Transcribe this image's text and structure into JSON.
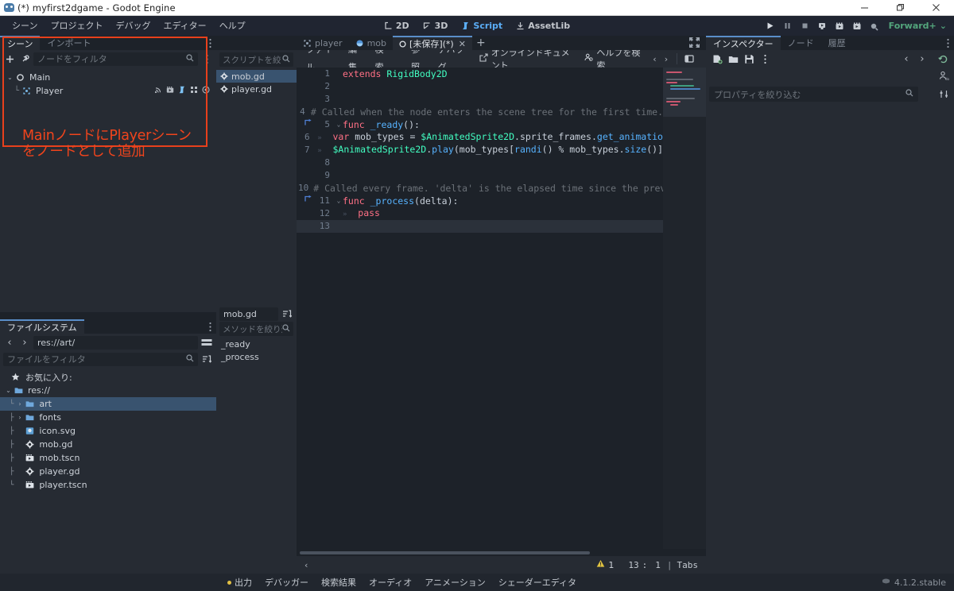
{
  "window": {
    "title": "(*) myfirst2dgame - Godot Engine",
    "logo": "godot-logo",
    "minimize": "—",
    "maximize": "❐",
    "close": "✕"
  },
  "menubar": {
    "items": [
      {
        "label": "シーン"
      },
      {
        "label": "プロジェクト"
      },
      {
        "label": "デバッグ"
      },
      {
        "label": "エディター"
      },
      {
        "label": "ヘルプ"
      }
    ],
    "main_tabs": [
      {
        "label": "2D",
        "icon": "2d-icon",
        "active": false
      },
      {
        "label": "3D",
        "icon": "3d-icon",
        "active": false
      },
      {
        "label": "Script",
        "icon": "script-icon",
        "active": true
      },
      {
        "label": "AssetLib",
        "icon": "assetlib-icon",
        "active": false
      }
    ],
    "play_controls": [
      {
        "name": "play-button",
        "glyph": "▶"
      },
      {
        "name": "pause-button",
        "glyph": "❙❙"
      },
      {
        "name": "stop-button",
        "glyph": "■"
      },
      {
        "name": "play-remote-debug-button",
        "glyph": "⚇"
      },
      {
        "name": "play-scene-button",
        "glyph": "▶"
      },
      {
        "name": "play-custom-scene-button",
        "glyph": "▶"
      },
      {
        "name": "movie-maker-button",
        "glyph": "●"
      }
    ],
    "renderer": {
      "label": "Forward+",
      "chevron": "⌄",
      "color": "#53a57c"
    }
  },
  "scene_panel": {
    "tabs": [
      {
        "label": "シーン",
        "active": true
      },
      {
        "label": "インポート",
        "active": false
      }
    ],
    "toolbar": {
      "add_node": "+",
      "instance_icon": "link-icon",
      "filter_placeholder": "ノードをフィルタ",
      "search_icon": "search-icon",
      "more_icon": "vertical-dots-icon"
    },
    "tree": [
      {
        "label": "Main",
        "depth": 0,
        "icon": "node2d-icon",
        "expander": "⌄",
        "icons": []
      },
      {
        "label": "Player",
        "depth": 1,
        "icon": "instance-icon",
        "expander": "",
        "icons": [
          "signal-icon",
          "instance-scene-icon",
          "script-icon",
          "group-icon",
          "visibility-icon"
        ]
      }
    ]
  },
  "annotation": {
    "text": "MainノードにPlayerシーン\nをノードとして追加",
    "color": "#f1441c"
  },
  "filesystem_panel": {
    "tabs": [
      {
        "label": "ファイルシステム",
        "active": true
      }
    ],
    "nav": {
      "back": "‹",
      "forward": "›",
      "path": "res://art/",
      "split_icon": "split-view-icon"
    },
    "filter": {
      "placeholder": "ファイルをフィルタ",
      "search_icon": "search-icon",
      "sort_icon": "sort-icon"
    },
    "tree": [
      {
        "label": "お気に入り:",
        "depth": 0,
        "icon": "star-icon",
        "expander": "",
        "selected": false
      },
      {
        "label": "res://",
        "depth": 0,
        "icon": "folder-icon",
        "expander": "⌄",
        "selected": false
      },
      {
        "label": "art",
        "depth": 1,
        "icon": "folder-icon",
        "expander": "›",
        "selected": true
      },
      {
        "label": "fonts",
        "depth": 1,
        "icon": "folder-icon",
        "expander": "›",
        "selected": false
      },
      {
        "label": "icon.svg",
        "depth": 1,
        "icon": "image-icon",
        "expander": "",
        "selected": false
      },
      {
        "label": "mob.gd",
        "depth": 1,
        "icon": "gdscript-icon",
        "expander": "",
        "selected": false
      },
      {
        "label": "mob.tscn",
        "depth": 1,
        "icon": "scene-icon",
        "expander": "",
        "selected": false
      },
      {
        "label": "player.gd",
        "depth": 1,
        "icon": "gdscript-icon",
        "expander": "",
        "selected": false
      },
      {
        "label": "player.tscn",
        "depth": 1,
        "icon": "scene-icon",
        "expander": "",
        "selected": false
      }
    ]
  },
  "script_list_panel": {
    "filter_placeholder": "スクリプトを絞り",
    "search_icon": "search-icon",
    "scripts": [
      {
        "label": "mob.gd",
        "icon": "gdscript-icon",
        "selected": true
      },
      {
        "label": "player.gd",
        "icon": "gdscript-icon",
        "selected": false
      }
    ],
    "members": {
      "current_file": "mob.gd",
      "sort_icon": "sort-icon",
      "filter_placeholder": "メソッドを絞り込",
      "search_icon": "search-icon",
      "items": [
        {
          "label": "_ready"
        },
        {
          "label": "_process"
        }
      ]
    }
  },
  "editor": {
    "tabs": [
      {
        "label": "player",
        "icon": "instance-icon",
        "active": false,
        "closable": false
      },
      {
        "label": "mob",
        "icon": "rigidbody-icon",
        "active": false,
        "closable": false
      },
      {
        "label": "[未保存](*)",
        "icon": "unsaved-icon",
        "active": true,
        "closable": true,
        "close": "✕"
      }
    ],
    "add_tab": "+",
    "expand_icon": "expand-icon",
    "menu": [
      {
        "label": "ファイル"
      },
      {
        "label": "編集"
      },
      {
        "label": "検索"
      },
      {
        "label": "参照"
      },
      {
        "label": "デバッグ"
      }
    ],
    "actions": [
      {
        "label": "オンラインドキュメント",
        "icon": "external-link-icon"
      },
      {
        "label": "ヘルプを検索",
        "icon": "help-search-icon"
      }
    ],
    "nav": {
      "prev": "‹",
      "next": "›",
      "toggle_panel_icon": "panel-toggle-icon"
    },
    "code": [
      {
        "n": 1,
        "bookmark": false,
        "fold": "",
        "indent": 0,
        "tokens": [
          {
            "t": "extends ",
            "c": "#ff7085"
          },
          {
            "t": "RigidBody2D",
            "c": "#42ffc2"
          }
        ]
      },
      {
        "n": 2,
        "bookmark": false,
        "fold": "",
        "indent": 0,
        "tokens": []
      },
      {
        "n": 3,
        "bookmark": false,
        "fold": "",
        "indent": 0,
        "tokens": []
      },
      {
        "n": 4,
        "bookmark": false,
        "fold": "",
        "indent": 0,
        "tokens": [
          {
            "t": "# Called when the node enters the scene tree for the first time.",
            "c": "#6b7178"
          }
        ]
      },
      {
        "n": 5,
        "bookmark": true,
        "fold": "⌄",
        "indent": 0,
        "tokens": [
          {
            "t": "func ",
            "c": "#ff7085"
          },
          {
            "t": "_ready",
            "c": "#57b3ff"
          },
          {
            "t": "():",
            "c": "#c8d0da"
          }
        ]
      },
      {
        "n": 6,
        "bookmark": false,
        "fold": "",
        "indent": 1,
        "tokens": [
          {
            "t": "var ",
            "c": "#ff7085"
          },
          {
            "t": "mob_types ",
            "c": "#c8d0da"
          },
          {
            "t": "= ",
            "c": "#c8d0da"
          },
          {
            "t": "$AnimatedSprite2D",
            "c": "#42ffc2"
          },
          {
            "t": ".",
            "c": "#c8d0da"
          },
          {
            "t": "sprite_frames",
            "c": "#c8d0da"
          },
          {
            "t": ".",
            "c": "#c8d0da"
          },
          {
            "t": "get_animatio",
            "c": "#57b3ff"
          }
        ]
      },
      {
        "n": 7,
        "bookmark": false,
        "fold": "",
        "indent": 1,
        "tokens": [
          {
            "t": "$AnimatedSprite2D",
            "c": "#42ffc2"
          },
          {
            "t": ".",
            "c": "#c8d0da"
          },
          {
            "t": "play",
            "c": "#57b3ff"
          },
          {
            "t": "(",
            "c": "#c8d0da"
          },
          {
            "t": "mob_types",
            "c": "#c8d0da"
          },
          {
            "t": "[",
            "c": "#c8d0da"
          },
          {
            "t": "randi",
            "c": "#57b3ff"
          },
          {
            "t": "() ",
            "c": "#c8d0da"
          },
          {
            "t": "% ",
            "c": "#c8d0da"
          },
          {
            "t": "mob_types",
            "c": "#c8d0da"
          },
          {
            "t": ".",
            "c": "#c8d0da"
          },
          {
            "t": "size",
            "c": "#57b3ff"
          },
          {
            "t": "()]",
            "c": "#c8d0da"
          }
        ]
      },
      {
        "n": 8,
        "bookmark": false,
        "fold": "",
        "indent": 0,
        "tokens": []
      },
      {
        "n": 9,
        "bookmark": false,
        "fold": "",
        "indent": 0,
        "tokens": []
      },
      {
        "n": 10,
        "bookmark": false,
        "fold": "",
        "indent": 0,
        "tokens": [
          {
            "t": "# Called every frame. 'delta' is the elapsed time since the prev",
            "c": "#6b7178"
          }
        ]
      },
      {
        "n": 11,
        "bookmark": true,
        "fold": "⌄",
        "indent": 0,
        "tokens": [
          {
            "t": "func ",
            "c": "#ff7085"
          },
          {
            "t": "_process",
            "c": "#57b3ff"
          },
          {
            "t": "(",
            "c": "#c8d0da"
          },
          {
            "t": "delta",
            "c": "#c8d0da"
          },
          {
            "t": "):",
            "c": "#c8d0da"
          }
        ]
      },
      {
        "n": 12,
        "bookmark": false,
        "fold": "",
        "indent": 1,
        "tokens": [
          {
            "t": "pass",
            "c": "#ff7085"
          }
        ]
      },
      {
        "n": 13,
        "bookmark": false,
        "fold": "",
        "indent": 0,
        "current": true,
        "tokens": []
      }
    ],
    "status": {
      "collapse": "‹",
      "warning_icon": "warning-triangle-icon",
      "warning_count": "1",
      "line": "13",
      "colon": ":",
      "column": "1",
      "sep": "|",
      "indent_mode": "Tabs"
    }
  },
  "inspector": {
    "tabs": [
      {
        "label": "インスペクター",
        "active": true
      },
      {
        "label": "ノード",
        "active": false
      },
      {
        "label": "履歴",
        "active": false
      }
    ],
    "toolbar": [
      {
        "name": "new-resource-icon"
      },
      {
        "name": "open-resource-icon"
      },
      {
        "name": "save-resource-icon"
      },
      {
        "name": "resource-menu-icon"
      }
    ],
    "nav": {
      "prev": "‹",
      "next": "›",
      "history_icon": "history-icon"
    },
    "side_icons": [
      {
        "name": "open-docs-icon"
      },
      {
        "name": "object-tools-icon"
      }
    ],
    "filter": {
      "placeholder": "プロパティを絞り込む",
      "search_icon": "search-icon"
    }
  },
  "bottom_dock": {
    "items": [
      {
        "label": "出力",
        "dot": true
      },
      {
        "label": "デバッガー",
        "dot": false
      },
      {
        "label": "検索結果",
        "dot": false
      },
      {
        "label": "オーディオ",
        "dot": false
      },
      {
        "label": "アニメーション",
        "dot": false
      },
      {
        "label": "シェーダーエディタ",
        "dot": false
      }
    ],
    "version": "4.1.2.stable",
    "version_icon": "godot-small-icon"
  }
}
